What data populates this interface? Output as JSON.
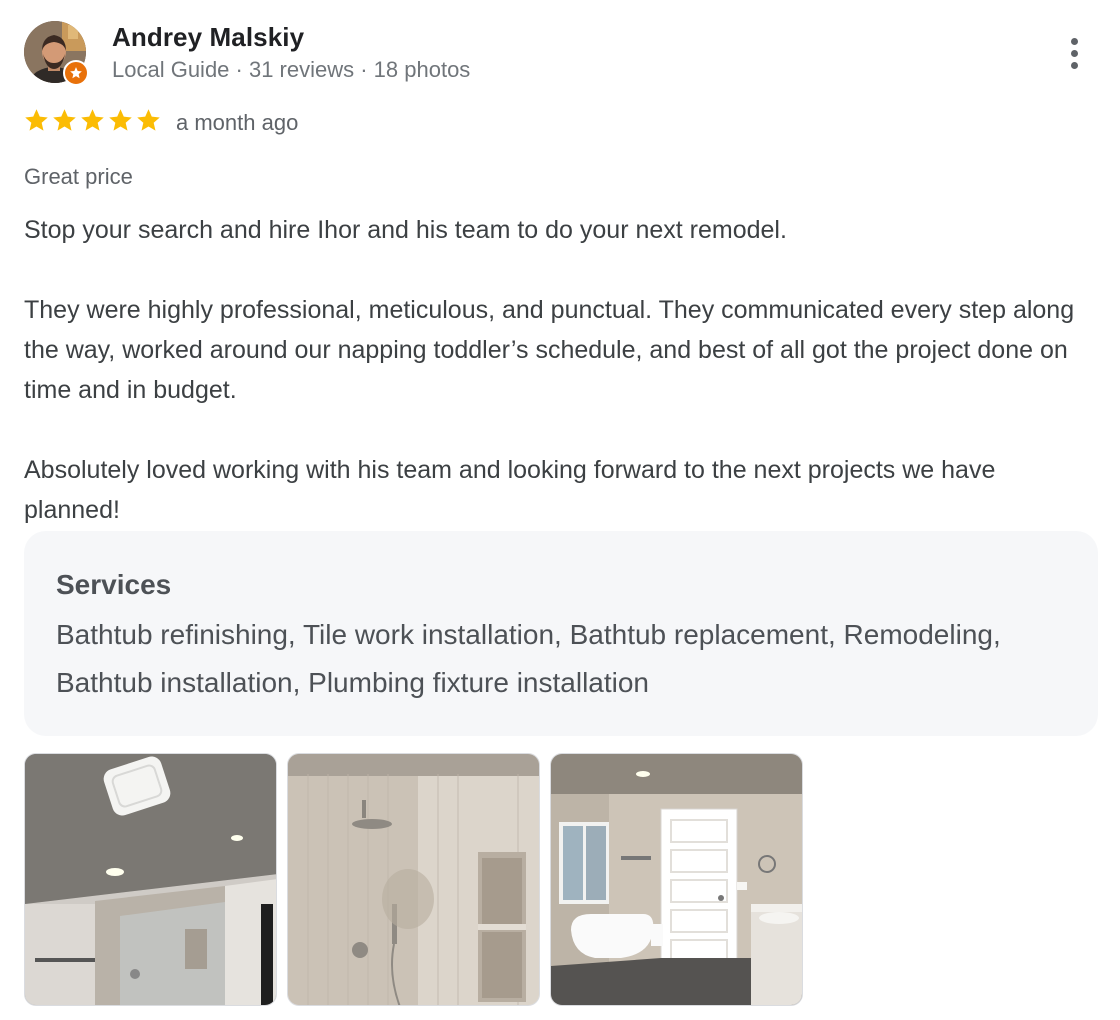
{
  "author": {
    "name": "Andrey Malskiy",
    "meta": "Local Guide · 31 reviews · 18 photos",
    "badge_icon": "local-guide-star-icon"
  },
  "review": {
    "rating": 5,
    "rating_max": 5,
    "date": "a month ago",
    "highlight": "Great price",
    "paragraphs": [
      "Stop your search and hire Ihor and his team to do your next remodel.",
      "They were highly professional, meticulous, and punctual. They communicated every step along the way, worked around our napping toddler’s schedule, and best of all got the project done on time and in budget.",
      "Absolutely loved working with his team and looking forward to the next projects we have planned!"
    ]
  },
  "services": {
    "title": "Services",
    "list": "Bathtub refinishing, Tile work installation, Bathtub replacement, Remodeling, Bathtub installation, Plumbing fixture installation"
  },
  "colors": {
    "star": "#fbbc04",
    "badge": "#e8710a",
    "services_bg": "#f6f7f9"
  },
  "photos": [
    {
      "icon": "bathroom-ceiling-photo"
    },
    {
      "icon": "shower-niche-photo"
    },
    {
      "icon": "bathtub-door-photo"
    }
  ]
}
